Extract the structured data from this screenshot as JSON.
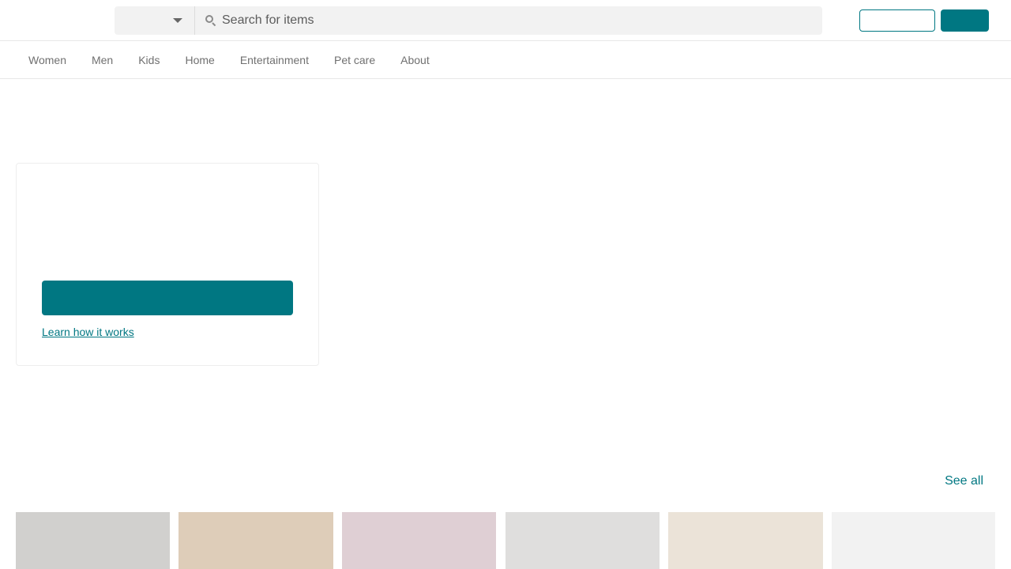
{
  "header": {
    "category_select_value": "",
    "search_placeholder": "Search for items",
    "outline_button_label": "",
    "filled_button_label": ""
  },
  "nav": {
    "items": [
      {
        "label": "Women"
      },
      {
        "label": "Men"
      },
      {
        "label": "Kids"
      },
      {
        "label": "Home"
      },
      {
        "label": "Entertainment"
      },
      {
        "label": "Pet care"
      },
      {
        "label": "About"
      }
    ]
  },
  "hero": {
    "cta_label": "",
    "learn_link": "Learn how it works"
  },
  "section": {
    "see_all_label": "See all",
    "tiles": [
      {
        "color": "#d1d0ce"
      },
      {
        "color": "#decdb9"
      },
      {
        "color": "#dfcfd4"
      },
      {
        "color": "#dfdedd"
      },
      {
        "color": "#ebe3d8"
      },
      {
        "color": "#f2f2f2"
      }
    ]
  },
  "colors": {
    "brand_accent": "#007782",
    "nav_text": "#707070",
    "search_bg": "#f2f2f2"
  }
}
